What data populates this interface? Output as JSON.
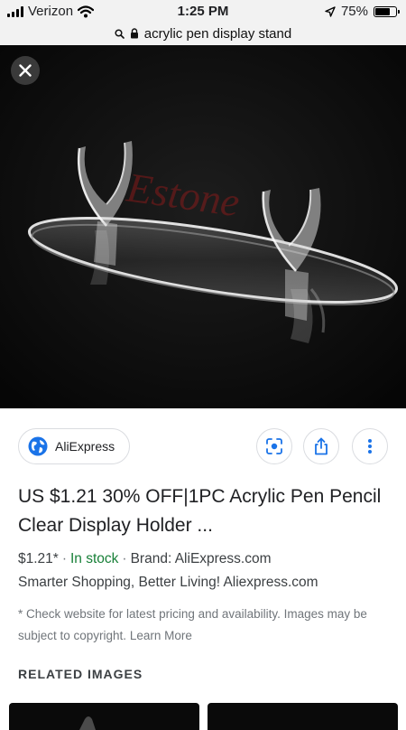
{
  "status_bar": {
    "carrier": "Verizon",
    "time": "1:25 PM",
    "battery": "75%",
    "battery_level": 0.75
  },
  "url_bar": {
    "query": "acrylic pen display stand"
  },
  "viewer": {
    "watermark": "Estone"
  },
  "result": {
    "source": "AliExpress",
    "title": "US $1.21 30% OFF|1PC Acrylic Pen Pencil Clear Display Holder ...",
    "price": "$1.21*",
    "stock": "In stock",
    "brand": "Brand: AliExpress.com",
    "description": "Smarter Shopping, Better Living! Aliexpress.com",
    "disclaimer": "* Check website for latest pricing and availability. Images may be subject to copyright.",
    "learn_more": "Learn More"
  },
  "related": {
    "heading": "RELATED IMAGES"
  },
  "colors": {
    "in_stock": "#188038",
    "accent_blue": "#1a73e8"
  }
}
